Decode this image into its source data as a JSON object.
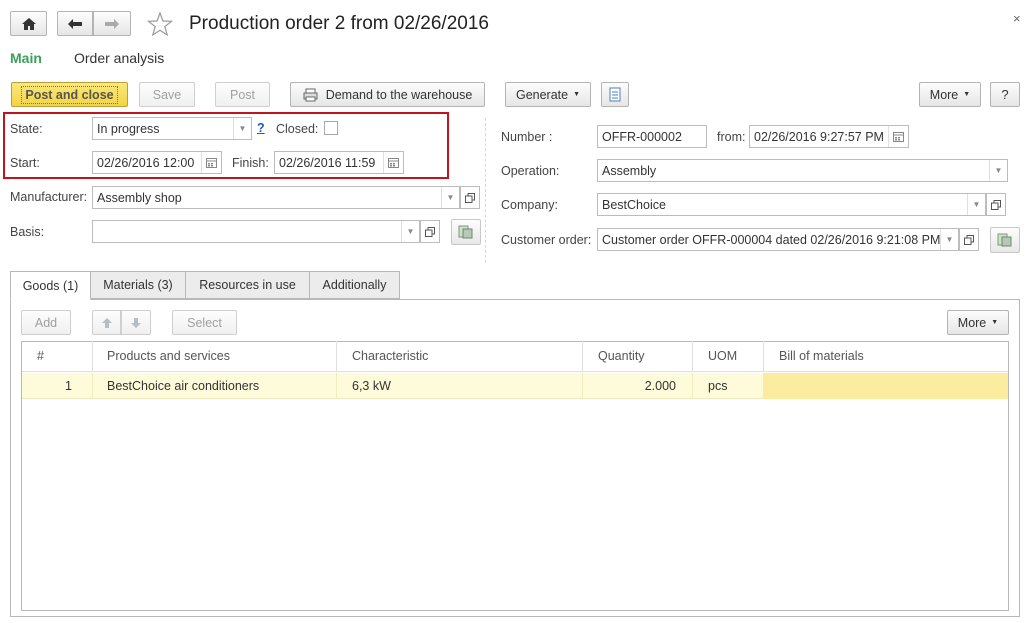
{
  "window": {
    "title": "Production order 2 from 02/26/2016"
  },
  "nav": {
    "tabs": [
      "Main",
      "Order analysis"
    ]
  },
  "toolbar": {
    "post_and_close": "Post and close",
    "save": "Save",
    "post": "Post",
    "demand": "Demand to the warehouse",
    "generate": "Generate",
    "more": "More",
    "help": "?"
  },
  "left": {
    "state_label": "State:",
    "state_value": "In progress",
    "state_help": "?",
    "closed_label": "Closed:",
    "start_label": "Start:",
    "start_value": "02/26/2016 12:00",
    "finish_label": "Finish:",
    "finish_value": "02/26/2016 11:59",
    "manufacturer_label": "Manufacturer:",
    "manufacturer_value": "Assembly shop",
    "basis_label": "Basis:",
    "basis_value": ""
  },
  "right": {
    "number_label": "Number :",
    "number_value": "OFFR-000002",
    "from_label": "from:",
    "from_value": "02/26/2016  9:27:57 PM",
    "operation_label": "Operation:",
    "operation_value": "Assembly",
    "company_label": "Company:",
    "company_value": "BestChoice",
    "customer_order_label": "Customer order:",
    "customer_order_value": "Customer order OFFR-000004 dated 02/26/2016 9:21:08 PM"
  },
  "tabs": [
    "Goods (1)",
    "Materials (3)",
    "Resources in use",
    "Additionally"
  ],
  "table_toolbar": {
    "add": "Add",
    "select": "Select",
    "more": "More"
  },
  "table": {
    "columns": [
      "#",
      "Products and services",
      "Characteristic",
      "Quantity",
      "UOM",
      "Bill of materials"
    ],
    "rows": [
      [
        "1",
        "BestChoice air conditioners",
        "6,3 kW",
        "2.000",
        "pcs",
        ""
      ]
    ]
  },
  "colors": {
    "accent_green": "#3aa05a",
    "highlight_red": "#c0141e",
    "row_highlight": "#fdfbd9",
    "default_button": "#f2d443"
  }
}
